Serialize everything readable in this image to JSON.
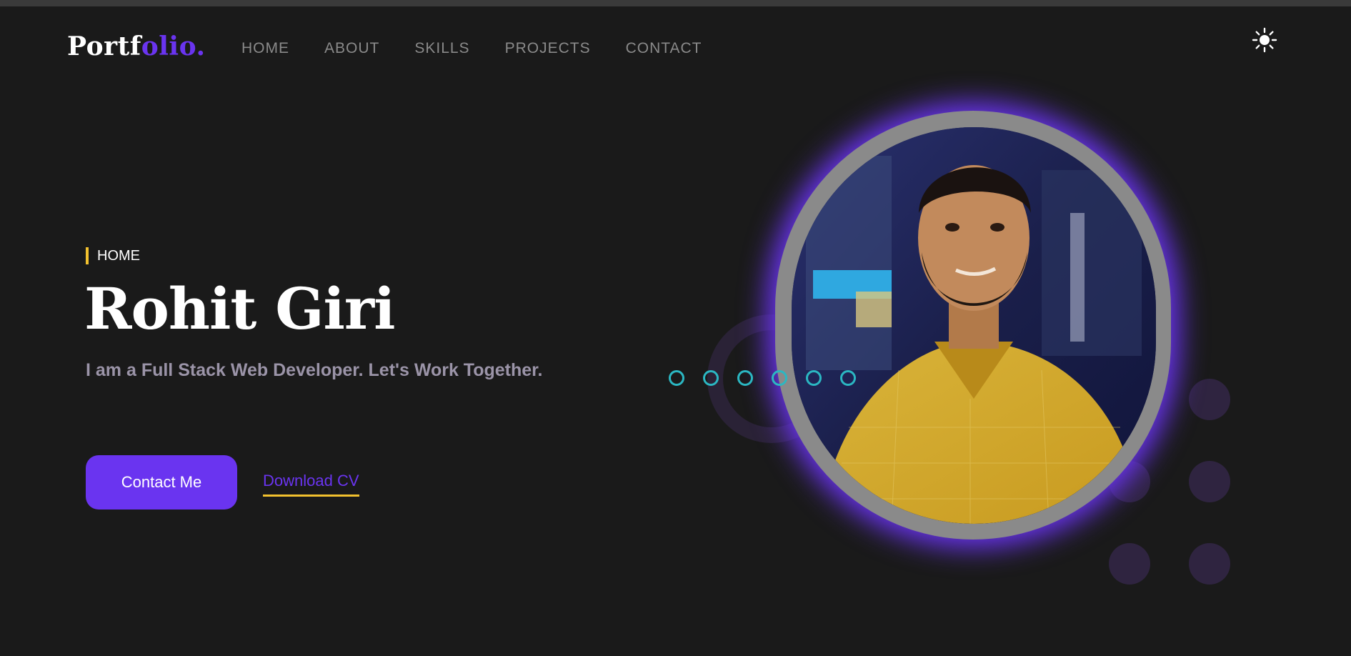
{
  "logo": {
    "part1": "Portf",
    "part2": "olio",
    "part3": "."
  },
  "nav": {
    "items": [
      "HOME",
      "ABOUT",
      "SKILLS",
      "PROJECTS",
      "CONTACT"
    ]
  },
  "theme_toggle": {
    "icon": "sun-icon"
  },
  "hero": {
    "eyebrow": "HOME",
    "name": "Rohit Giri",
    "tagline": "I am a Full Stack Web Developer. Let's Work Together.",
    "contact_label": "Contact Me",
    "download_label": "Download CV"
  },
  "colors": {
    "background": "#1a1a1a",
    "accent": "#6a34f0",
    "highlight": "#f2c12e",
    "teal": "#2bb7c2"
  }
}
